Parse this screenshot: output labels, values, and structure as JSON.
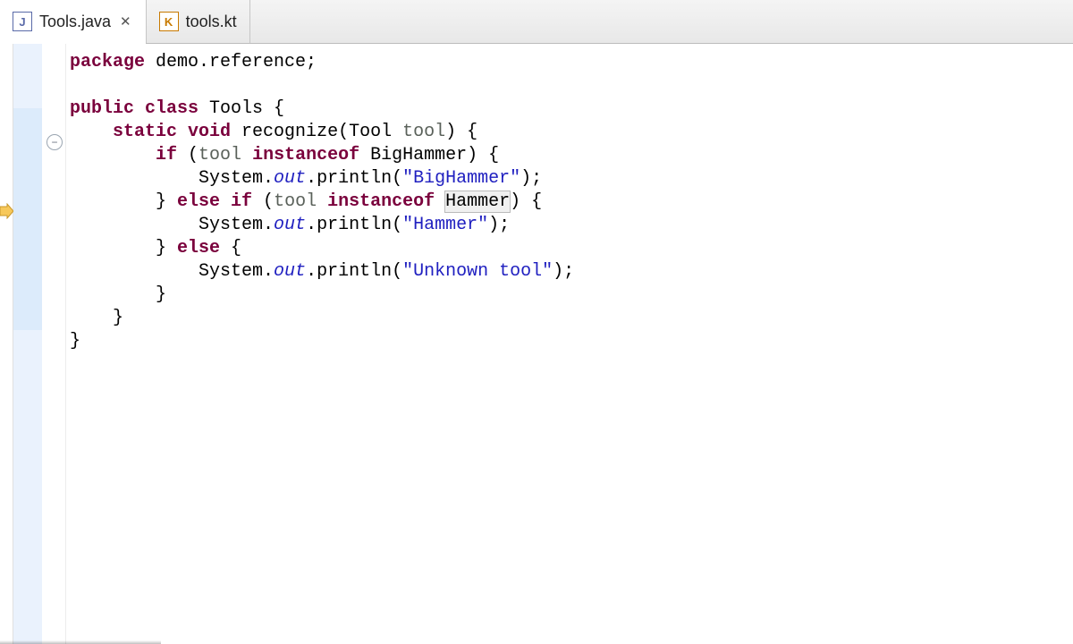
{
  "tabs": {
    "active": {
      "label": "Tools.java"
    },
    "other": {
      "label": "tools.kt"
    }
  },
  "code": {
    "line1": {
      "kw": "package",
      "rest": " demo.reference;"
    },
    "line3": {
      "kw": "public class",
      "rest": " Tools {"
    },
    "line4": {
      "indent": "    ",
      "kw": "static void",
      "rest1": " recognize(Tool ",
      "param": "tool",
      "rest2": ") {"
    },
    "line5": {
      "indent": "        ",
      "kw": "if",
      "rest1": " (",
      "param": "tool",
      "sp": " ",
      "kw2": "instanceof",
      "rest2": " BigHammer) {"
    },
    "line6": {
      "indent": "            ",
      "rest1": "System.",
      "it": "out",
      "rest2": ".println(",
      "str": "\"BigHammer\"",
      "rest3": ");"
    },
    "line7": {
      "indent": "        ",
      "rest1": "} ",
      "kw": "else if",
      "rest2": " (",
      "param": "tool",
      "sp": " ",
      "kw2": "instanceof",
      "rest3": " ",
      "hl": "Hammer",
      "rest4": ") {"
    },
    "line8": {
      "indent": "            ",
      "rest1": "System.",
      "it": "out",
      "rest2": ".println(",
      "str": "\"Hammer\"",
      "rest3": ");"
    },
    "line9": {
      "indent": "        ",
      "rest1": "} ",
      "kw": "else",
      "rest2": " {"
    },
    "line10": {
      "indent": "            ",
      "rest1": "System.",
      "it": "out",
      "rest2": ".println(",
      "str": "\"Unknown tool\"",
      "rest3": ");"
    },
    "line11": {
      "indent": "        ",
      "brace": "}"
    },
    "line12": {
      "indent": "    ",
      "brace": "}"
    },
    "line13": {
      "brace": "}"
    }
  },
  "icons": {
    "java": "J",
    "kotlin": "K",
    "close": "✕",
    "fold_minus": "−"
  }
}
